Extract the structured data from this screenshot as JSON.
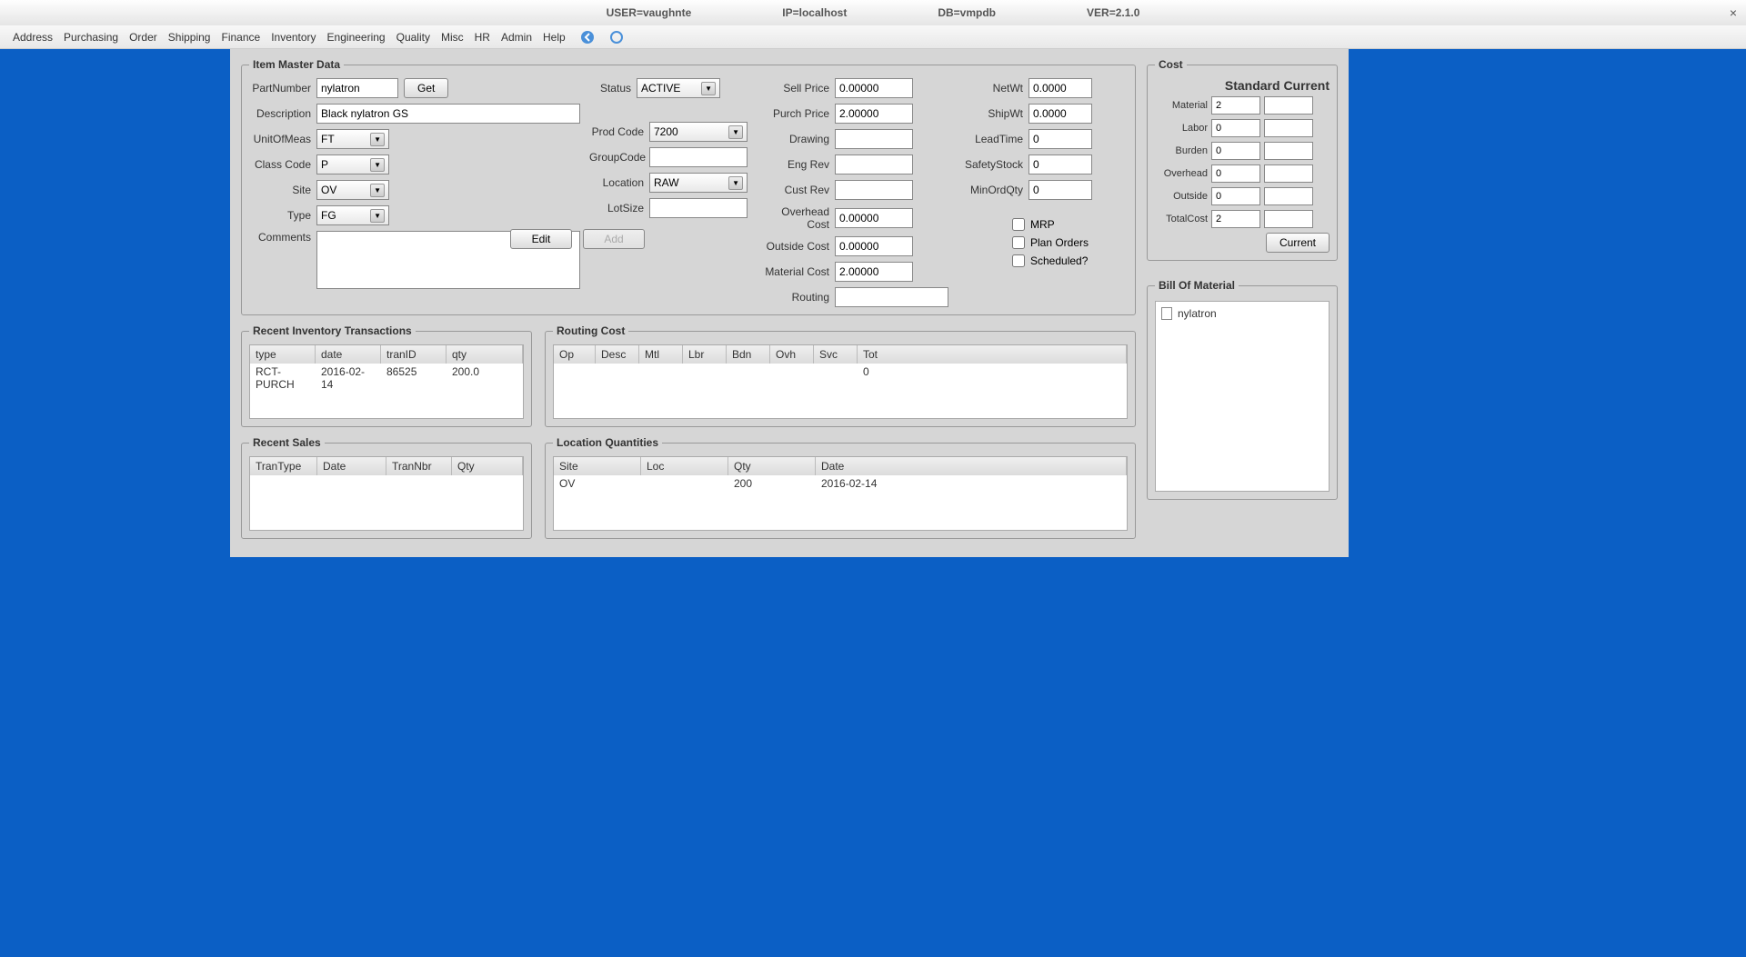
{
  "titlebar": {
    "user": "USER=vaughnte",
    "ip": "IP=localhost",
    "db": "DB=vmpdb",
    "ver": "VER=2.1.0"
  },
  "menu": {
    "address": "Address",
    "purchasing": "Purchasing",
    "order": "Order",
    "shipping": "Shipping",
    "finance": "Finance",
    "inventory": "Inventory",
    "engineering": "Engineering",
    "quality": "Quality",
    "misc": "Misc",
    "hr": "HR",
    "admin": "Admin",
    "help": "Help"
  },
  "itemMaster": {
    "legend": "Item Master Data",
    "labels": {
      "partNumber": "PartNumber",
      "description": "Description",
      "unitOfMeas": "UnitOfMeas",
      "classCode": "Class Code",
      "site": "Site",
      "type": "Type",
      "comments": "Comments",
      "status": "Status",
      "prodCode": "Prod Code",
      "groupCode": "GroupCode",
      "location": "Location",
      "lotSize": "LotSize",
      "sellPrice": "Sell Price",
      "purchPrice": "Purch Price",
      "drawing": "Drawing",
      "engRev": "Eng Rev",
      "custRev": "Cust Rev",
      "overheadCost": "Overhead Cost",
      "outsideCost": "Outside Cost",
      "materialCost": "Material Cost",
      "routing": "Routing",
      "netWt": "NetWt",
      "shipWt": "ShipWt",
      "leadTime": "LeadTime",
      "safetyStock": "SafetyStock",
      "minOrdQty": "MinOrdQty",
      "mrp": "MRP",
      "planOrders": "Plan Orders",
      "scheduled": "Scheduled?"
    },
    "values": {
      "partNumber": "nylatron",
      "description": "Black nylatron GS",
      "unitOfMeas": "FT",
      "classCode": "P",
      "site": "OV",
      "type": "FG",
      "status": "ACTIVE",
      "prodCode": "7200",
      "groupCode": "",
      "location": "RAW",
      "lotSize": "",
      "sellPrice": "0.00000",
      "purchPrice": "2.00000",
      "drawing": "",
      "engRev": "",
      "custRev": "",
      "overheadCost": "0.00000",
      "outsideCost": "0.00000",
      "materialCost": "2.00000",
      "routing": "",
      "netWt": "0.0000",
      "shipWt": "0.0000",
      "leadTime": "0",
      "safetyStock": "0",
      "minOrdQty": "0",
      "comments": ""
    },
    "buttons": {
      "get": "Get",
      "edit": "Edit",
      "add": "Add"
    }
  },
  "cost": {
    "legend": "Cost",
    "header": "Standard Current",
    "labels": {
      "material": "Material",
      "labor": "Labor",
      "burden": "Burden",
      "overhead": "Overhead",
      "outside": "Outside",
      "totalCost": "TotalCost"
    },
    "standard": {
      "material": "2",
      "labor": "0",
      "burden": "0",
      "overhead": "0",
      "outside": "0",
      "totalCost": "2"
    },
    "current": {
      "material": "",
      "labor": "",
      "burden": "",
      "overhead": "",
      "outside": "",
      "totalCost": ""
    },
    "button": "Current"
  },
  "bom": {
    "legend": "Bill Of Material",
    "item": "nylatron"
  },
  "recentInv": {
    "legend": "Recent Inventory Transactions",
    "headers": {
      "type": "type",
      "date": "date",
      "tranID": "tranID",
      "qty": "qty"
    },
    "rows": [
      {
        "type": "RCT-PURCH",
        "date": "2016-02-14",
        "tranID": "86525",
        "qty": "200.0"
      }
    ]
  },
  "recentSales": {
    "legend": "Recent Sales",
    "headers": {
      "tranType": "TranType",
      "date": "Date",
      "tranNbr": "TranNbr",
      "qty": "Qty"
    }
  },
  "routingCost": {
    "legend": "Routing Cost",
    "headers": {
      "op": "Op",
      "desc": "Desc",
      "mtl": "Mtl",
      "lbr": "Lbr",
      "bdn": "Bdn",
      "ovh": "Ovh",
      "svc": "Svc",
      "tot": "Tot"
    },
    "rows": [
      {
        "op": "",
        "desc": "",
        "mtl": "",
        "lbr": "",
        "bdn": "",
        "ovh": "",
        "svc": "",
        "tot": "0"
      }
    ]
  },
  "locQty": {
    "legend": "Location Quantities",
    "headers": {
      "site": "Site",
      "loc": "Loc",
      "qty": "Qty",
      "date": "Date"
    },
    "rows": [
      {
        "site": "OV",
        "loc": "",
        "qty": "200",
        "date": "2016-02-14"
      }
    ]
  }
}
